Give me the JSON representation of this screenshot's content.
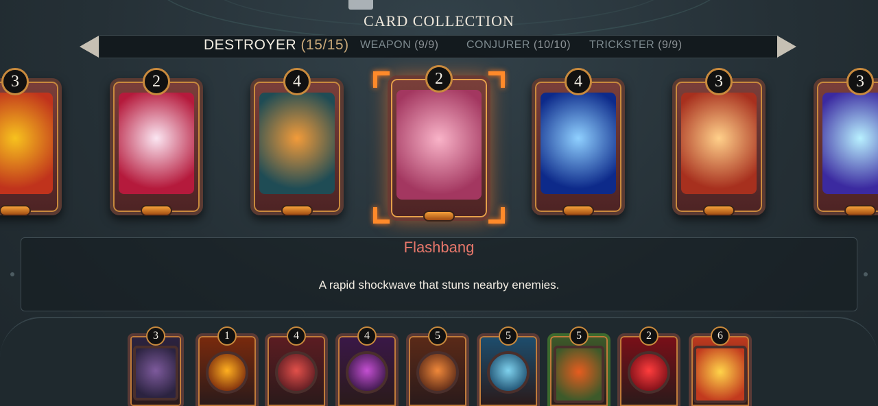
{
  "header": {
    "title": "CARD COLLECTION"
  },
  "categories": [
    {
      "name": "DESTROYER",
      "count": "(15/15)",
      "active": true
    },
    {
      "name": "WEAPON",
      "count": "(9/9)",
      "active": false
    },
    {
      "name": "CONJURER",
      "count": "(10/10)",
      "active": false
    },
    {
      "name": "TRICKSTER",
      "count": "(9/9)",
      "active": false
    }
  ],
  "carousel": {
    "cards": [
      {
        "cost": "3",
        "art": "explosion-bat-art",
        "c1": "#f7c21e",
        "c2": "#c0331c"
      },
      {
        "cost": "2",
        "art": "flash-burst-art",
        "c1": "#fbe6f2",
        "c2": "#b51a3c"
      },
      {
        "cost": "4",
        "art": "falling-bombs-art",
        "c1": "#f29b3a",
        "c2": "#1f4c55"
      },
      {
        "cost": "2",
        "art": "dizzy-bat-art",
        "c1": "#f9b3c8",
        "c2": "#a33760"
      },
      {
        "cost": "4",
        "art": "blue-comet-art",
        "c1": "#8fd0ff",
        "c2": "#0d2a8a"
      },
      {
        "cost": "3",
        "art": "sword-skull-art",
        "c1": "#ffd08a",
        "c2": "#a7301e"
      },
      {
        "cost": "3",
        "art": "lightning-art",
        "c1": "#b8f1ff",
        "c2": "#3b2aa0"
      }
    ],
    "selected_index": 3
  },
  "detail": {
    "name": "Flashbang",
    "description": "A rapid shockwave that stuns nearby enemies."
  },
  "deck": [
    {
      "cost": "3",
      "art": "axe-warrior-art",
      "c1": "#7d5a9c",
      "c2": "#2b2340"
    },
    {
      "cost": "1",
      "art": "skull-bomb-art",
      "c1": "#ffb020",
      "c2": "#7a2a0d"
    },
    {
      "cost": "4",
      "art": "fire-medal-art",
      "c1": "#e2504a",
      "c2": "#5c1c22"
    },
    {
      "cost": "4",
      "art": "purple-gear-art",
      "c1": "#c44fd2",
      "c2": "#3a1848"
    },
    {
      "cost": "5",
      "art": "claw-medal-art",
      "c1": "#f0883a",
      "c2": "#5b2a18"
    },
    {
      "cost": "5",
      "art": "wave-medal-art",
      "c1": "#7fd2ee",
      "c2": "#1d4e6e"
    },
    {
      "cost": "5",
      "art": "fire-fox-art",
      "c1": "#e65c1f",
      "c2": "#3d5a2a"
    },
    {
      "cost": "2",
      "art": "red-potion-art",
      "c1": "#ff3d3d",
      "c2": "#7a0f18"
    },
    {
      "cost": "6",
      "art": "fireworks-art",
      "c1": "#ffd44a",
      "c2": "#c23a1e"
    }
  ],
  "colors": {
    "accent": "#ff8a2a",
    "card_name": "#e8776b",
    "active_count": "#c9a97a"
  }
}
